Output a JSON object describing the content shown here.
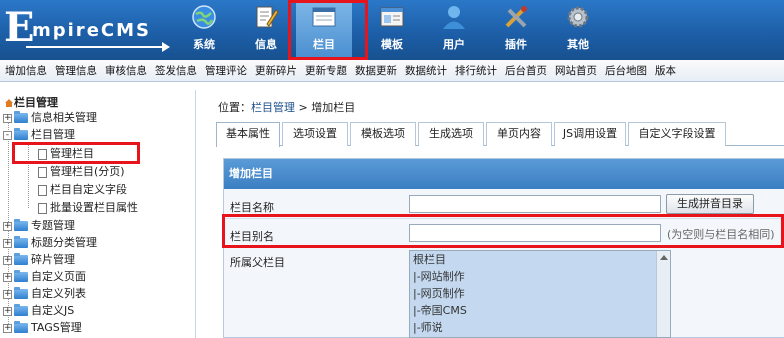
{
  "logo": {
    "big_letter": "E",
    "text": "mpireCMS"
  },
  "nav": [
    {
      "label": "系统",
      "icon": "globe-icon"
    },
    {
      "label": "信息",
      "icon": "document-edit-icon"
    },
    {
      "label": "栏目",
      "icon": "window-column-icon"
    },
    {
      "label": "模板",
      "icon": "template-window-icon"
    },
    {
      "label": "用户",
      "icon": "user-icon"
    },
    {
      "label": "插件",
      "icon": "tools-icon"
    },
    {
      "label": "其他",
      "icon": "gear-icon"
    }
  ],
  "toolbar": [
    "增加信息",
    "管理信息",
    "审核信息",
    "签发信息",
    "管理评论",
    "更新碎片",
    "更新专题",
    "数据更新",
    "数据统计",
    "排行统计",
    "后台首页",
    "网站首页",
    "后台地图",
    "版本"
  ],
  "sidebar": {
    "title": "栏目管理",
    "items": [
      {
        "label": "信息相关管理",
        "type": "folder",
        "expander": "+"
      },
      {
        "label": "栏目管理",
        "type": "folder",
        "expander": "-"
      },
      {
        "label": "管理栏目",
        "type": "page"
      },
      {
        "label": "管理栏目(分页)",
        "type": "page"
      },
      {
        "label": "栏目自定义字段",
        "type": "page"
      },
      {
        "label": "批量设置栏目属性",
        "type": "page"
      },
      {
        "label": "专题管理",
        "type": "folder",
        "expander": "+"
      },
      {
        "label": "标题分类管理",
        "type": "folder",
        "expander": "+"
      },
      {
        "label": "碎片管理",
        "type": "folder",
        "expander": "+"
      },
      {
        "label": "自定义页面",
        "type": "folder",
        "expander": "+"
      },
      {
        "label": "自定义列表",
        "type": "folder",
        "expander": "+"
      },
      {
        "label": "自定义JS",
        "type": "folder",
        "expander": "+"
      },
      {
        "label": "TAGS管理",
        "type": "folder",
        "expander": "+"
      }
    ]
  },
  "breadcrumb": {
    "prefix": "位置：",
    "link": "栏目管理",
    "sep": " > ",
    "current": "增加栏目"
  },
  "tabs": [
    "基本属性",
    "选项设置",
    "模板选项",
    "生成选项",
    "单页内容",
    "JS调用设置",
    "自定义字段设置"
  ],
  "form": {
    "header": "增加栏目",
    "name_label": "栏目名称",
    "name_value": "",
    "pinyin_button": "生成拼音目录",
    "alias_label": "栏目别名",
    "alias_value": "",
    "alias_hint": "(为空则与栏目名相同)",
    "parent_label": "所属父栏目",
    "parent_options": [
      "根栏目",
      "|-网站制作",
      "|-网页制作",
      "|-帝国CMS",
      "|-师说"
    ]
  },
  "colors": {
    "highlight_red": "#e8141b",
    "header_blue": "#1d5fa8",
    "form_head_blue": "#4a8bca"
  }
}
